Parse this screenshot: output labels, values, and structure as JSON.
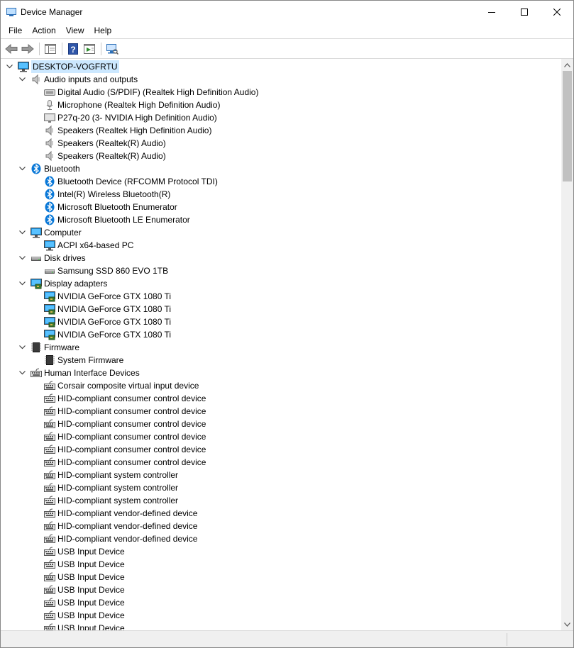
{
  "window": {
    "title": "Device Manager"
  },
  "menu": [
    "File",
    "Action",
    "View",
    "Help"
  ],
  "tree": {
    "root": "DESKTOP-VOGFRTU",
    "categories": [
      {
        "label": "Audio inputs and outputs",
        "icon": "speaker-icon",
        "children": [
          {
            "label": "Digital Audio (S/PDIF) (Realtek High Definition Audio)",
            "icon": "spdif-icon"
          },
          {
            "label": "Microphone (Realtek High Definition Audio)",
            "icon": "microphone-icon"
          },
          {
            "label": "P27q-20 (3- NVIDIA High Definition Audio)",
            "icon": "monitor-audio-icon"
          },
          {
            "label": "Speakers (Realtek High Definition Audio)",
            "icon": "speaker-icon"
          },
          {
            "label": "Speakers (Realtek(R) Audio)",
            "icon": "speaker-icon"
          },
          {
            "label": "Speakers (Realtek(R) Audio)",
            "icon": "speaker-icon"
          }
        ]
      },
      {
        "label": "Bluetooth",
        "icon": "bluetooth-icon",
        "children": [
          {
            "label": "Bluetooth Device (RFCOMM Protocol TDI)",
            "icon": "bluetooth-icon"
          },
          {
            "label": "Intel(R) Wireless Bluetooth(R)",
            "icon": "bluetooth-icon"
          },
          {
            "label": "Microsoft Bluetooth Enumerator",
            "icon": "bluetooth-icon"
          },
          {
            "label": "Microsoft Bluetooth LE Enumerator",
            "icon": "bluetooth-icon"
          }
        ]
      },
      {
        "label": "Computer",
        "icon": "computer-icon",
        "children": [
          {
            "label": "ACPI x64-based PC",
            "icon": "computer-icon"
          }
        ]
      },
      {
        "label": "Disk drives",
        "icon": "disk-drive-icon",
        "children": [
          {
            "label": "Samsung SSD 860 EVO 1TB",
            "icon": "disk-drive-icon"
          }
        ]
      },
      {
        "label": "Display adapters",
        "icon": "display-adapter-icon",
        "children": [
          {
            "label": "NVIDIA GeForce GTX 1080 Ti",
            "icon": "display-adapter-icon"
          },
          {
            "label": "NVIDIA GeForce GTX 1080 Ti",
            "icon": "display-adapter-icon"
          },
          {
            "label": "NVIDIA GeForce GTX 1080 Ti",
            "icon": "display-adapter-icon"
          },
          {
            "label": "NVIDIA GeForce GTX 1080 Ti",
            "icon": "display-adapter-icon"
          }
        ]
      },
      {
        "label": "Firmware",
        "icon": "firmware-icon",
        "children": [
          {
            "label": "System Firmware",
            "icon": "firmware-icon"
          }
        ]
      },
      {
        "label": "Human Interface Devices",
        "icon": "hid-icon",
        "children": [
          {
            "label": "Corsair composite virtual input device",
            "icon": "hid-icon"
          },
          {
            "label": "HID-compliant consumer control device",
            "icon": "hid-icon"
          },
          {
            "label": "HID-compliant consumer control device",
            "icon": "hid-icon"
          },
          {
            "label": "HID-compliant consumer control device",
            "icon": "hid-icon"
          },
          {
            "label": "HID-compliant consumer control device",
            "icon": "hid-icon"
          },
          {
            "label": "HID-compliant consumer control device",
            "icon": "hid-icon"
          },
          {
            "label": "HID-compliant consumer control device",
            "icon": "hid-icon"
          },
          {
            "label": "HID-compliant system controller",
            "icon": "hid-icon"
          },
          {
            "label": "HID-compliant system controller",
            "icon": "hid-icon"
          },
          {
            "label": "HID-compliant system controller",
            "icon": "hid-icon"
          },
          {
            "label": "HID-compliant vendor-defined device",
            "icon": "hid-icon"
          },
          {
            "label": "HID-compliant vendor-defined device",
            "icon": "hid-icon"
          },
          {
            "label": "HID-compliant vendor-defined device",
            "icon": "hid-icon"
          },
          {
            "label": "USB Input Device",
            "icon": "hid-icon"
          },
          {
            "label": "USB Input Device",
            "icon": "hid-icon"
          },
          {
            "label": "USB Input Device",
            "icon": "hid-icon"
          },
          {
            "label": "USB Input Device",
            "icon": "hid-icon"
          },
          {
            "label": "USB Input Device",
            "icon": "hid-icon"
          },
          {
            "label": "USB Input Device",
            "icon": "hid-icon"
          },
          {
            "label": "USB Input Device",
            "icon": "hid-icon"
          }
        ]
      }
    ]
  }
}
